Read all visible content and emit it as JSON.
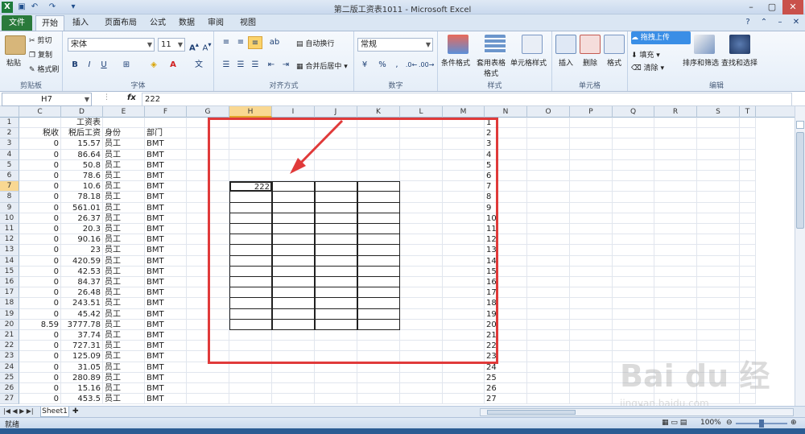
{
  "window": {
    "title": "第二版工资表1011 - Microsoft Excel"
  },
  "tabs": [
    "文件",
    "开始",
    "插入",
    "页面布局",
    "公式",
    "数据",
    "审阅",
    "视图"
  ],
  "ribbon": {
    "clipboard": {
      "paste": "粘贴",
      "cut": "剪切",
      "copy": "复制",
      "format_painter": "格式刷",
      "label": "剪贴板"
    },
    "font": {
      "name": "宋体",
      "size": "11",
      "label": "字体"
    },
    "alignment": {
      "wrap": "自动换行",
      "merge": "合并后居中",
      "label": "对齐方式"
    },
    "number": {
      "format": "常规",
      "label": "数字"
    },
    "styles": {
      "cond": "条件格式",
      "table": "套用表格格式",
      "cell": "单元格样式",
      "label": "样式"
    },
    "cells": {
      "insert": "插入",
      "delete": "删除",
      "format": "格式",
      "label": "单元格"
    },
    "editing": {
      "fill": "填充",
      "clear": "清除",
      "sort": "排序和筛选",
      "find": "查找和选择",
      "label": "编辑",
      "upload": "拖拽上传"
    }
  },
  "formula_bar": {
    "name_box": "H7",
    "fx": "fx",
    "value": "222"
  },
  "columns": [
    "C",
    "D",
    "E",
    "F",
    "G",
    "H",
    "I",
    "J",
    "K",
    "L",
    "M",
    "N",
    "O",
    "P",
    "Q",
    "R",
    "S",
    "T"
  ],
  "rows": [
    {
      "n": "1",
      "c": "",
      "d": "工资表",
      "e": "",
      "f": ""
    },
    {
      "n": "2",
      "c": "税收",
      "d": "税后工资",
      "e": "身份",
      "f": "部门"
    },
    {
      "n": "3",
      "c": "0",
      "d": "15.57",
      "e": "员工",
      "f": "BMT"
    },
    {
      "n": "4",
      "c": "0",
      "d": "86.64",
      "e": "员工",
      "f": "BMT"
    },
    {
      "n": "5",
      "c": "0",
      "d": "50.8",
      "e": "员工",
      "f": "BMT"
    },
    {
      "n": "6",
      "c": "0",
      "d": "78.6",
      "e": "员工",
      "f": "BMT"
    },
    {
      "n": "7",
      "c": "0",
      "d": "10.6",
      "e": "员工",
      "f": "BMT",
      "h": "222"
    },
    {
      "n": "8",
      "c": "0",
      "d": "78.18",
      "e": "员工",
      "f": "BMT"
    },
    {
      "n": "9",
      "c": "0",
      "d": "561.01",
      "e": "员工",
      "f": "BMT"
    },
    {
      "n": "10",
      "c": "0",
      "d": "26.37",
      "e": "员工",
      "f": "BMT"
    },
    {
      "n": "11",
      "c": "0",
      "d": "20.3",
      "e": "员工",
      "f": "BMT"
    },
    {
      "n": "12",
      "c": "0",
      "d": "90.16",
      "e": "员工",
      "f": "BMT"
    },
    {
      "n": "13",
      "c": "0",
      "d": "23",
      "e": "员工",
      "f": "BMT"
    },
    {
      "n": "14",
      "c": "0",
      "d": "420.59",
      "e": "员工",
      "f": "BMT"
    },
    {
      "n": "15",
      "c": "0",
      "d": "42.53",
      "e": "员工",
      "f": "BMT"
    },
    {
      "n": "16",
      "c": "0",
      "d": "84.37",
      "e": "员工",
      "f": "BMT"
    },
    {
      "n": "17",
      "c": "0",
      "d": "26.48",
      "e": "员工",
      "f": "BMT"
    },
    {
      "n": "18",
      "c": "0",
      "d": "243.51",
      "e": "员工",
      "f": "BMT"
    },
    {
      "n": "19",
      "c": "0",
      "d": "45.42",
      "e": "员工",
      "f": "BMT"
    },
    {
      "n": "20",
      "c": "8.59",
      "d": "3777.78",
      "e": "员工",
      "f": "BMT"
    },
    {
      "n": "21",
      "c": "0",
      "d": "37.74",
      "e": "员工",
      "f": "BMT"
    },
    {
      "n": "22",
      "c": "0",
      "d": "727.31",
      "e": "员工",
      "f": "BMT"
    },
    {
      "n": "23",
      "c": "0",
      "d": "125.09",
      "e": "员工",
      "f": "BMT"
    },
    {
      "n": "24",
      "c": "0",
      "d": "31.05",
      "e": "员工",
      "f": "BMT"
    },
    {
      "n": "25",
      "c": "0",
      "d": "280.89",
      "e": "员工",
      "f": "BMT"
    },
    {
      "n": "26",
      "c": "0",
      "d": "15.16",
      "e": "员工",
      "f": "BMT"
    },
    {
      "n": "27",
      "c": "0",
      "d": "453.5",
      "e": "员工",
      "f": "BMT"
    }
  ],
  "sheet_tab": "Sheet1",
  "status": {
    "ready": "就绪",
    "zoom": "100%"
  },
  "watermark": {
    "brand": "Bai du 经验",
    "url": "jingyan.baidu.com"
  },
  "colors": {
    "excel_green": "#2a7a3b",
    "highlight_red": "#e03a3a",
    "selected_header": "#f9d892"
  }
}
